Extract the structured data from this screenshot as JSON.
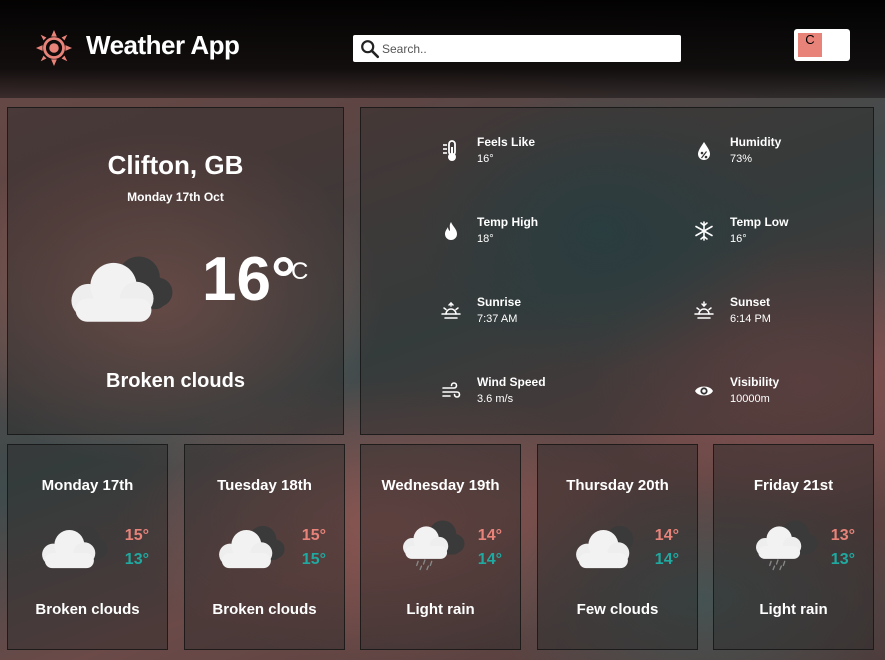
{
  "header": {
    "title": "Weather App",
    "logo_icon": "sun-gear-icon",
    "search": {
      "placeholder": "Search..",
      "icon": "search-icon"
    },
    "unit_toggle": {
      "label": "C",
      "color": "#e8837a"
    }
  },
  "current": {
    "city": "Clifton, GB",
    "date": "Monday 17th Oct",
    "temp": "16°",
    "unit": "C",
    "icon": "broken-clouds-icon",
    "description": "Broken clouds"
  },
  "details": [
    {
      "label": "Feels Like",
      "value": "16°",
      "icon": "thermometer-icon"
    },
    {
      "label": "Humidity",
      "value": "73%",
      "icon": "humidity-drop-icon"
    },
    {
      "label": "Temp High",
      "value": "18°",
      "icon": "flame-icon"
    },
    {
      "label": "Temp Low",
      "value": "16°",
      "icon": "snowflake-icon"
    },
    {
      "label": "Sunrise",
      "value": "7:37 AM",
      "icon": "sunrise-icon"
    },
    {
      "label": "Sunset",
      "value": "6:14 PM",
      "icon": "sunset-icon"
    },
    {
      "label": "Wind Speed",
      "value": "3.6 m/s",
      "icon": "wind-icon"
    },
    {
      "label": "Visibility",
      "value": "10000m",
      "icon": "eye-icon"
    }
  ],
  "forecast": [
    {
      "day": "Monday 17th",
      "high": "15°",
      "low": "13°",
      "description": "Broken clouds",
      "icon": "broken-clouds-icon"
    },
    {
      "day": "Tuesday 18th",
      "high": "15°",
      "low": "15°",
      "description": "Broken clouds",
      "icon": "broken-clouds-icon"
    },
    {
      "day": "Wednesday 19th",
      "high": "14°",
      "low": "14°",
      "description": "Light rain",
      "icon": "light-rain-icon"
    },
    {
      "day": "Thursday 20th",
      "high": "14°",
      "low": "14°",
      "description": "Few clouds",
      "icon": "few-clouds-icon"
    },
    {
      "day": "Friday 21st",
      "high": "13°",
      "low": "13°",
      "description": "Light rain",
      "icon": "light-rain-icon"
    }
  ],
  "colors": {
    "high": "#e8837a",
    "low": "#1fa9a0",
    "accent": "#e8837a"
  }
}
